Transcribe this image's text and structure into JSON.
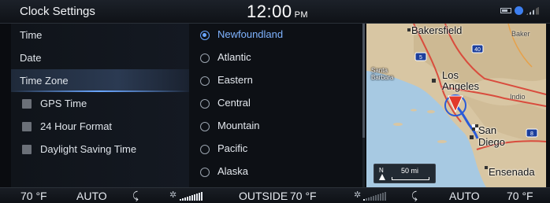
{
  "header": {
    "title": "Clock Settings",
    "time": "12:00",
    "ampm": "PM"
  },
  "status_icons": [
    "battery-icon",
    "bluetooth-icon",
    "signal-icon"
  ],
  "menu": {
    "items": [
      {
        "label": "Time",
        "type": "plain"
      },
      {
        "label": "Date",
        "type": "plain"
      },
      {
        "label": "Time Zone",
        "type": "plain",
        "selected": true
      },
      {
        "label": "GPS Time",
        "type": "checkbox",
        "checked": false
      },
      {
        "label": "24 Hour Format",
        "type": "checkbox",
        "checked": false
      },
      {
        "label": "Daylight Saving Time",
        "type": "checkbox",
        "checked": false
      }
    ]
  },
  "timezones": {
    "selected": "Newfoundland",
    "items": [
      "Newfoundland",
      "Atlantic",
      "Eastern",
      "Central",
      "Mountain",
      "Pacific",
      "Alaska"
    ]
  },
  "map": {
    "places": [
      "Bakersfield",
      "Baker",
      "Santa Barbara",
      "Los Angeles",
      "Indio",
      "San Diego",
      "Ensenada"
    ],
    "highways": [
      "40",
      "5",
      "8"
    ],
    "scale_north": "N",
    "scale_distance": "50 mi",
    "colors": {
      "land": "#d9c7a6",
      "water": "#9fc4e0",
      "route": "#2a5bd8"
    }
  },
  "climate": {
    "left_temp": "70 °F",
    "left_mode": "AUTO",
    "outside_label": "OUTSIDE",
    "outside_temp": "70 °F",
    "right_mode": "AUTO",
    "right_temp": "70 °F",
    "left_fan_level": 5,
    "right_fan_level": 1
  },
  "colors": {
    "accent": "#6aa6ff",
    "background": "#0a0c10"
  }
}
